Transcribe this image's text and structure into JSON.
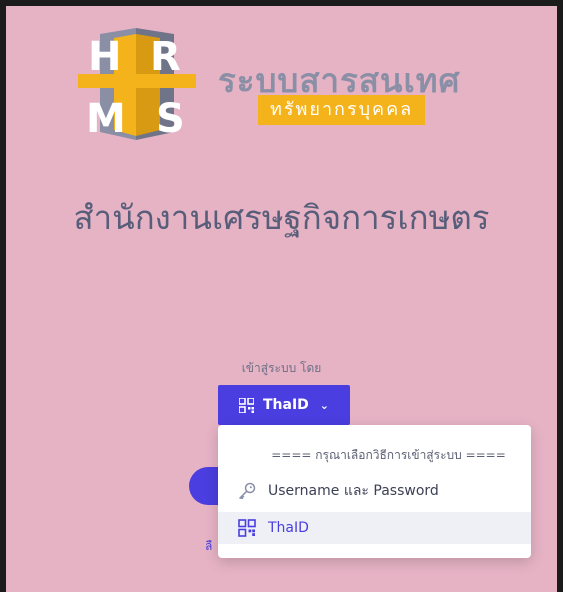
{
  "brand": {
    "logo_letters": [
      "H",
      "R",
      "M",
      "S"
    ],
    "title": "ระบบสารสนเทศ",
    "subtitle": "ทรัพยากรบุคคล"
  },
  "organization": "สำนักงานเศรษฐกิจการเกษตร",
  "login": {
    "label": "เข้าสู่ระบบ โดย",
    "selected_method": "ThaID",
    "partial_link_text": "ลื"
  },
  "dropdown": {
    "header": "==== กรุณาเลือกวิธีการเข้าสู่ระบบ ====",
    "options": [
      {
        "label": "Username และ Password",
        "icon": "key-icon"
      },
      {
        "label": "ThaID",
        "icon": "qr-code-icon",
        "selected": true
      }
    ]
  },
  "colors": {
    "background": "#e6b3c5",
    "accent": "#4a3ee0",
    "brand_title": "#8a8fa6",
    "brand_badge": "#f4b21b"
  }
}
